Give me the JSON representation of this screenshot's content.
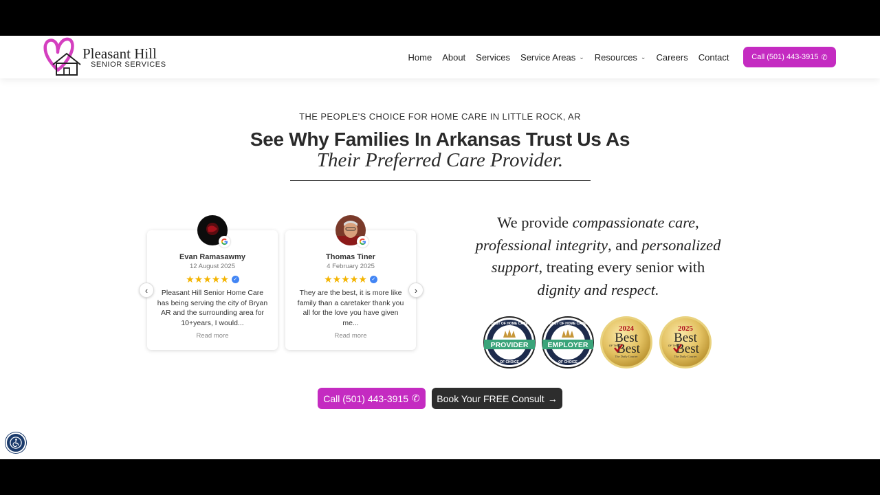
{
  "brand": {
    "name": "Pleasant Hill",
    "subtitle": "SENIOR  SERVICES",
    "accent_color": "#c42bc1",
    "dark_button_color": "#2d2d2d"
  },
  "nav": {
    "items": [
      {
        "label": "Home",
        "has_dropdown": false
      },
      {
        "label": "About",
        "has_dropdown": false
      },
      {
        "label": "Services",
        "has_dropdown": false
      },
      {
        "label": "Service Areas",
        "has_dropdown": true
      },
      {
        "label": "Resources",
        "has_dropdown": true
      },
      {
        "label": "Careers",
        "has_dropdown": false
      },
      {
        "label": "Contact",
        "has_dropdown": false
      }
    ],
    "call_label": "Call (501) 443-3915"
  },
  "hero": {
    "eyebrow": "THE PEOPLE'S CHOICE FOR HOME CARE IN LITTLE ROCK, AR",
    "headline": "See Why Families In Arkansas Trust Us As",
    "headline_italic": "Their Preferred Care Provider."
  },
  "reviews": [
    {
      "name": "Evan Ramasawmy",
      "date": "12 August 2025",
      "rating": 5,
      "text": "Pleasant Hill Senior Home Care has being serving the city of Bryan AR and the surrounding area for 10+years, I would...",
      "read_more": "Read more"
    },
    {
      "name": "Thomas Tiner",
      "date": "4 February 2025",
      "rating": 5,
      "text": "They are the best, it is more like family than a caretaker thank you all for the love you have given me...",
      "read_more": "Read more"
    }
  ],
  "quote": {
    "p1": "We provide ",
    "i1": "compassionate care",
    "p2": ", ",
    "i2": "professional integrity",
    "p3": ", and ",
    "i3": "personalized support",
    "p4": ", treating every senior with ",
    "i4": "dignity and respect."
  },
  "badges": [
    {
      "arc": "BEST OF HOME CARE",
      "label": "PROVIDER",
      "sub": "OF CHOICE"
    },
    {
      "arc": "BEST OF HOME CARE",
      "label": "EMPLOYER",
      "sub": "OF CHOICE"
    },
    {
      "year": "2024",
      "title": "Best",
      "title2": "Best",
      "small": "OF THE",
      "paper": "The Daily Courier"
    },
    {
      "year": "2025",
      "title": "Best",
      "title2": "Best",
      "small": "OF THE",
      "paper": "The Daily Courier"
    }
  ],
  "cta": {
    "call_label": "Call (501) 443-3915",
    "book_label": "Book Your FREE Consult"
  }
}
